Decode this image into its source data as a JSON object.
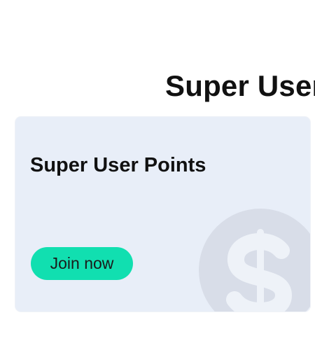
{
  "header": {
    "title": "Super User"
  },
  "card": {
    "title": "Super User Points",
    "button_label": "Join now",
    "icon": "dollar-icon"
  },
  "colors": {
    "card_background": "#e8eef8",
    "button_background": "#11dfb0",
    "icon_circle": "#d8dde8"
  }
}
